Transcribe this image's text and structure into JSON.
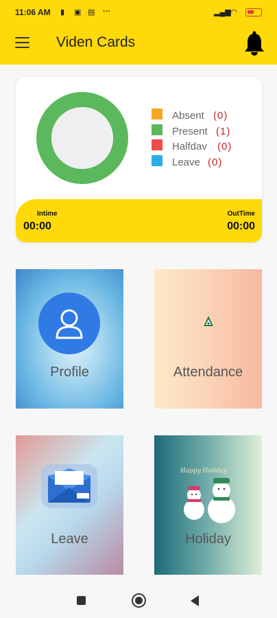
{
  "status_bar": {
    "time": "11:06 AM",
    "more_dots": "···"
  },
  "app_bar": {
    "title": "Viden Cards",
    "menu_icon": "menu-icon",
    "bell_icon": "bell-icon",
    "color": "#ffd909"
  },
  "summary": {
    "legend": [
      {
        "label": "Absent",
        "count": "(0)",
        "color": "#f5a623"
      },
      {
        "label": "Present",
        "count": "(1)",
        "color": "#5cb85c"
      },
      {
        "label": "Halfdav",
        "count": "(0)",
        "color": "#ef4b4b"
      },
      {
        "label": "Leave",
        "count": "(0)",
        "color": "#29aee6"
      }
    ],
    "donut_ring_color": "#5cb85c",
    "intime_label": "Intime",
    "intime_value": "00:00",
    "outtime_label": "OutTime",
    "outtime_value": "00:00"
  },
  "tiles": [
    {
      "label": "Profile",
      "icon": "user-icon"
    },
    {
      "label": "Attendance",
      "icon": "attendance-logo-icon"
    },
    {
      "label": "Leave",
      "icon": "envelope-icon"
    },
    {
      "label": "Holiday",
      "icon": "snowman-icon"
    }
  ],
  "nav": {
    "recent": "square-icon",
    "home": "home-circle-icon",
    "back": "back-triangle-icon"
  }
}
